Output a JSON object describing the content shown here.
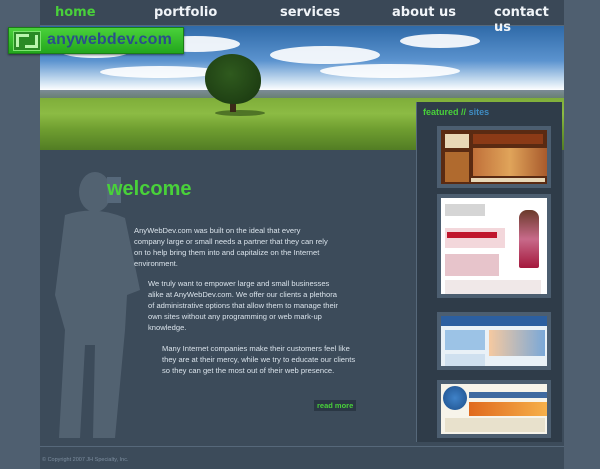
{
  "nav": {
    "items": [
      {
        "label": "home",
        "active": true
      },
      {
        "label": "portfolio",
        "active": false
      },
      {
        "label": "services",
        "active": false
      },
      {
        "label": "about us",
        "active": false
      },
      {
        "label": "contact us",
        "active": false
      }
    ]
  },
  "logo": {
    "text": "anywebdev.com",
    "icon": "logo-mark-icon"
  },
  "featured": {
    "title": "featured",
    "separator": "//",
    "subtitle": "sites"
  },
  "welcome": {
    "title": "welcome",
    "paragraphs": [
      "AnyWebDev.com was built on the ideal that every company large or small needs a partner that they can rely on to help bring them into and capitalize on the Internet environment.",
      "We truly want to empower large and small businesses alike at AnyWebDev.com. We offer our clients a plethora of administrative options that allow them to manage their own sites without any programming or web mark-up knowledge.",
      "Many Internet companies make their customers feel like they are at their mercy, while we try to educate our clients so they can get the most out of their web presence."
    ],
    "read_more": "read more"
  },
  "footer": {
    "copyright": "© Copyright 2007 JH Specialty, Inc."
  },
  "colors": {
    "accent": "#49d13a",
    "background": "#3c4b5a",
    "nav_active": "#49d13a"
  }
}
